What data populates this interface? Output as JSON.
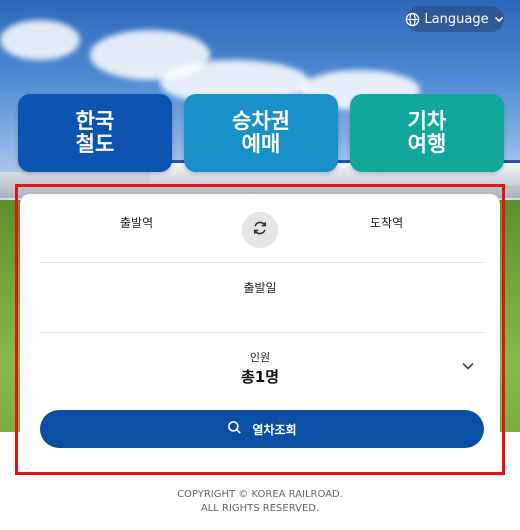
{
  "header": {
    "language_label": "Language"
  },
  "nav": {
    "tiles": [
      {
        "line1": "한국",
        "line2": "철도"
      },
      {
        "line1": "승차권",
        "line2": "예매"
      },
      {
        "line1": "기차",
        "line2": "여행"
      }
    ]
  },
  "booking": {
    "departure_label": "출발역",
    "arrival_label": "도착역",
    "date_label": "출발일",
    "passengers_label": "인원",
    "passengers_value": "총1명",
    "search_button_label": "열차조회"
  },
  "footer": {
    "line1": "COPYRIGHT © KOREA RAILROAD.",
    "line2": "ALL RIGHTS RESERVED."
  },
  "colors": {
    "tile_korea_rail": "#0d54b0",
    "tile_ticket": "#1a90c9",
    "tile_travel": "#12a79d",
    "search_button": "#0a4fa3",
    "highlight": "#e01414"
  },
  "icons": {
    "language": "globe-icon",
    "language_dropdown": "chevron-down-icon",
    "swap": "swap-arrows-icon",
    "passengers_dropdown": "chevron-down-icon",
    "search": "search-icon"
  }
}
